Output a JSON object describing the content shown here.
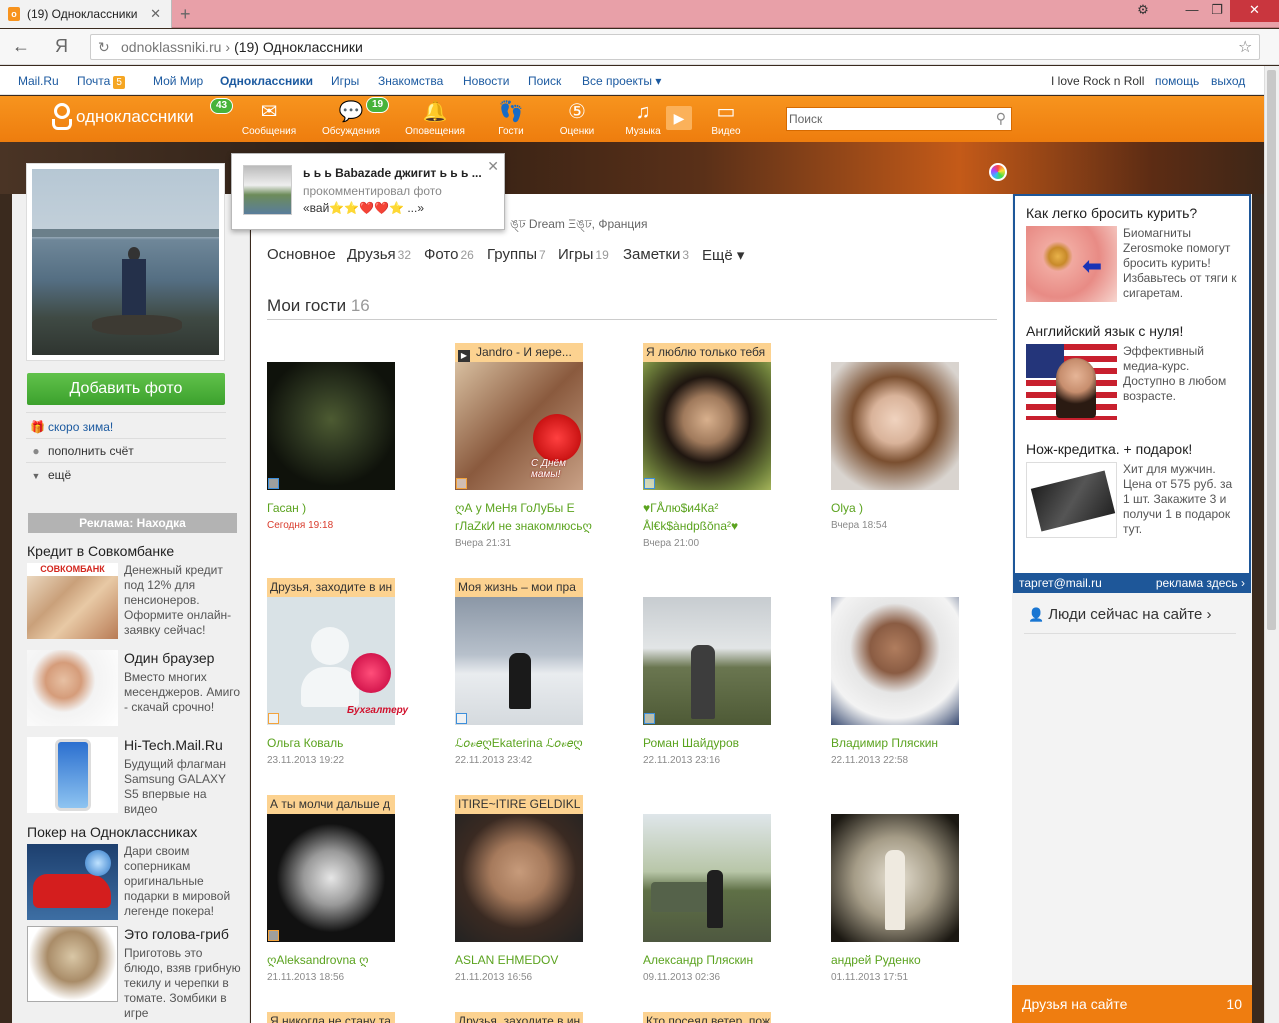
{
  "browser": {
    "tab_title": "(19) Одноклассники",
    "tab_favicon": "ok",
    "new_tab": "+",
    "url_domain": "odnoklassniki.ru",
    "url_sep": "›",
    "url_title": "(19) Одноклассники",
    "yandex": "Я"
  },
  "portal": {
    "links": [
      "Mail.Ru",
      "Почта",
      "Мой Мир",
      "Одноклассники",
      "Игры",
      "Знакомства",
      "Новости",
      "Поиск",
      "Все проекты ▾"
    ],
    "mail_badge": "5",
    "user": "I love Rock n Roll",
    "help": "помощь",
    "logout": "выход"
  },
  "toolbar": {
    "logo_text": "одноклассники",
    "logo_badge": "43",
    "items": [
      {
        "label": "Сообщения",
        "icon": "envelope-icon"
      },
      {
        "label": "Обсуждения",
        "icon": "chat-icon",
        "badge": "19"
      },
      {
        "label": "Оповещения",
        "icon": "bell-icon"
      },
      {
        "label": "Гости",
        "icon": "footprints-icon"
      },
      {
        "label": "Оценки",
        "icon": "rating-icon"
      },
      {
        "label": "Музыка",
        "icon": "music-icon"
      },
      {
        "label": "Видео",
        "icon": "video-icon"
      }
    ],
    "search_placeholder": "Поиск"
  },
  "notification": {
    "name": "ь ь ь Babazade джигит ь ь ь ...",
    "action": "прокомментировал фото",
    "text": "«вай⭐⭐❤️❤️⭐ ...»"
  },
  "left": {
    "add_photo": "Добавить фото",
    "menu": [
      {
        "label": "скоро зима!",
        "icon": "gift-icon"
      },
      {
        "label": "пополнить счёт",
        "icon": "coin-icon"
      },
      {
        "label": "ещё",
        "icon": "triangle-down-icon"
      }
    ],
    "ads_header": "Реклама: Находка",
    "ads": [
      {
        "title": "Кредит в Совкомбанке",
        "text": "Денежный кредит под 12% для пенсионеров. Оформите онлайн-заявку сейчас!",
        "brand": "СОВКОМБАНК"
      },
      {
        "title": "Один браузер",
        "text": "Вместо многих месенджеров. Амиго - скачай срочно!"
      },
      {
        "title": "Hi-Tech.Mail.Ru",
        "text": "Будущий флагман Samsung GALAXY S5 впервые на видео"
      },
      {
        "title": "Покер на Одноклассниках",
        "text": "Дари своим соперникам оригинальные подарки в мировой легенде покера!"
      },
      {
        "title": "Это голова-гриб",
        "text": "Приготовь это блюдо, взяв грибную текилу и черепки в томате. Зомбики в игре"
      }
    ]
  },
  "profile": {
    "location": "ঙ্ঢ Dream Ξঙ্ঢ, Франция",
    "tabs": [
      {
        "label": "Основное",
        "count": ""
      },
      {
        "label": "Друзья",
        "count": "32"
      },
      {
        "label": "Фото",
        "count": "26"
      },
      {
        "label": "Группы",
        "count": "7"
      },
      {
        "label": "Игры",
        "count": "19"
      },
      {
        "label": "Заметки",
        "count": "3"
      },
      {
        "label": "Ещё ▾",
        "count": ""
      }
    ]
  },
  "guests": {
    "title": "Мои гости",
    "count": "16",
    "items": [
      {
        "status": "",
        "name": "Гасан )",
        "time": "Сегодня 19:18",
        "today": true
      },
      {
        "status": "Jandro - И яере...",
        "status_play": true,
        "name": "ღА у МеНя ГоЛуБы Е гЛаZкИ не знакомлюсьღ",
        "time": "Вчера 21:31"
      },
      {
        "status": "Я люблю только тебя",
        "name": "♥ГÅлю$и4Ка² Ål€k$àнdрßŏnа²♥",
        "time": "Вчера 21:00"
      },
      {
        "status": "",
        "name": "Olya )",
        "time": "Вчера 18:54"
      },
      {
        "status": "Друзья, заходите в ин",
        "name": "Ольга Коваль",
        "time": "23.11.2013 19:22"
      },
      {
        "status": "Моя жизнь – мои пра",
        "name": "ℒ𝑜𝓋𝑒ღEkaterina ℒ𝑜𝓋𝑒ღ",
        "time": "22.11.2013 23:42"
      },
      {
        "status": "",
        "name": "Роман Шайдуров",
        "time": "22.11.2013 23:16"
      },
      {
        "status": "",
        "name": "Владимир Пляскин",
        "time": "22.11.2013 22:58"
      },
      {
        "status": "А ты молчи дальше д",
        "name": "ღAleksandrovna ღ",
        "time": "21.11.2013 18:56"
      },
      {
        "status": "ITIRE~ITIRE GELDIKL",
        "name": "ASLAN EHMEDOV",
        "time": "21.11.2013 16:56"
      },
      {
        "status": "",
        "name": "Александр Пляскин",
        "time": "09.11.2013 02:36"
      },
      {
        "status": "",
        "name": "андрей Руденко",
        "time": "01.11.2013 17:51"
      },
      {
        "status": "Я никогда не стану та",
        "name": "",
        "time": ""
      },
      {
        "status": "Друзья, заходите в ин",
        "name": "",
        "time": ""
      },
      {
        "status": "Кто посеял ветер, пож",
        "name": "",
        "time": ""
      }
    ],
    "gift_texts": [
      "С Днём мамы!",
      "Бухгалтеру"
    ]
  },
  "right": {
    "ads": [
      {
        "title": "Как легко бросить курить?",
        "text": "Биомагниты Zerosmoke помогут бросить курить! Избавьтесь от тяги к сигаретам."
      },
      {
        "title": "Английский язык с нуля!",
        "text": "Эффективный медиа-курс. Доступно в любом возрасте."
      },
      {
        "title": "Нож-кредитка. + подарок!",
        "text": "Хит для мужчин. Цена от 575 руб. за 1 шт. Закажите 3 и получи 1 в подарок тут."
      }
    ],
    "target_logo": "таргет@mail.ru",
    "target_link": "реклама здесь ›",
    "people_now": "Люди сейчас на сайте ›",
    "friends_online": "Друзья на сайте",
    "friends_count": "10"
  }
}
